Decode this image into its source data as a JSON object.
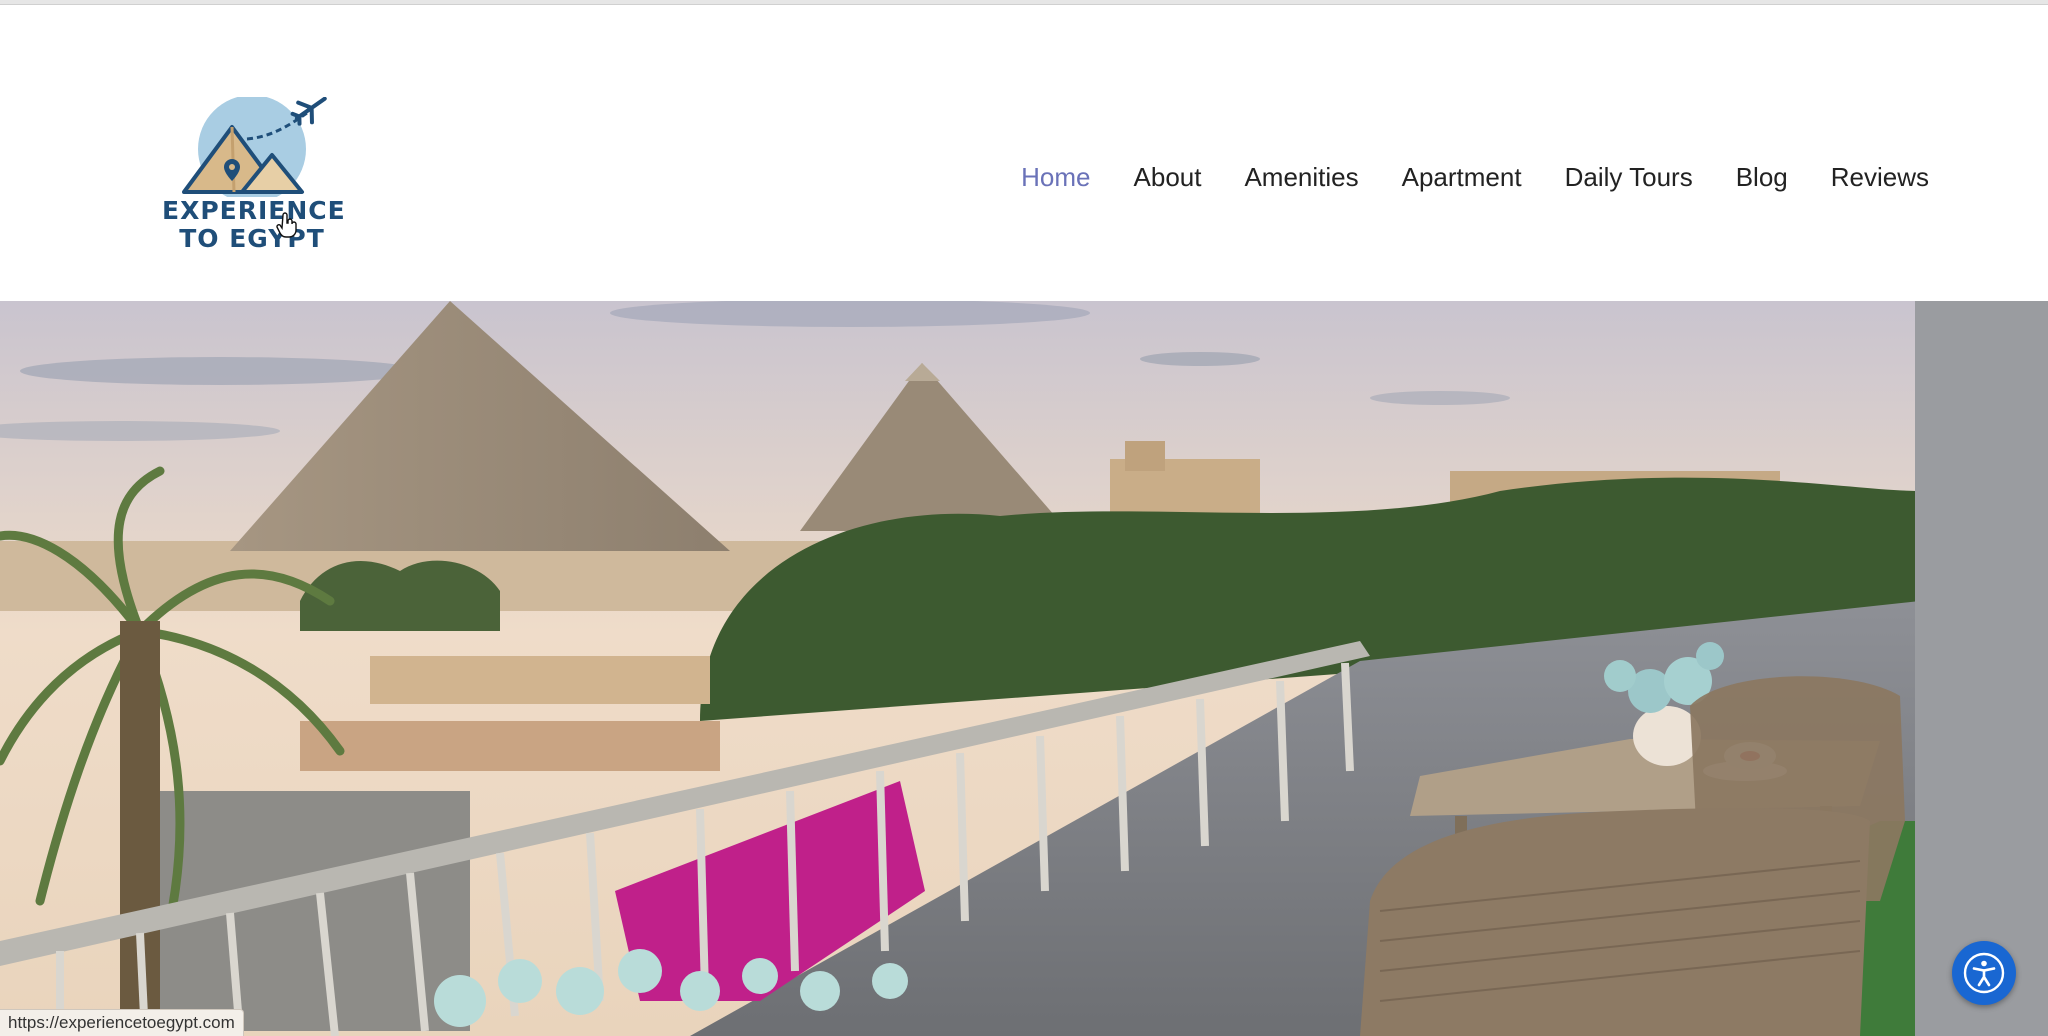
{
  "logo": {
    "line1": "EXPERIENCE",
    "line2": "TO EGYPT"
  },
  "nav": {
    "items": [
      {
        "label": "Home",
        "active": true
      },
      {
        "label": "About"
      },
      {
        "label": "Amenities"
      },
      {
        "label": "Apartment"
      },
      {
        "label": "Daily Tours"
      },
      {
        "label": "Blog"
      },
      {
        "label": "Reviews"
      }
    ]
  },
  "status_bar": {
    "url": "https://experiencetoegypt.com"
  },
  "hero": {
    "image_icon": "hero-photo-pyramids-balcony"
  },
  "accessibility": {
    "icon": "accessibility-icon"
  },
  "colors": {
    "nav_active": "#6a72b8",
    "nav_text": "#222222",
    "logo_text": "#1f4e79",
    "logo_circle": "#a9cde3",
    "pyramid_sand": "#d8b98a",
    "accessibility_button": "#1967d2"
  }
}
